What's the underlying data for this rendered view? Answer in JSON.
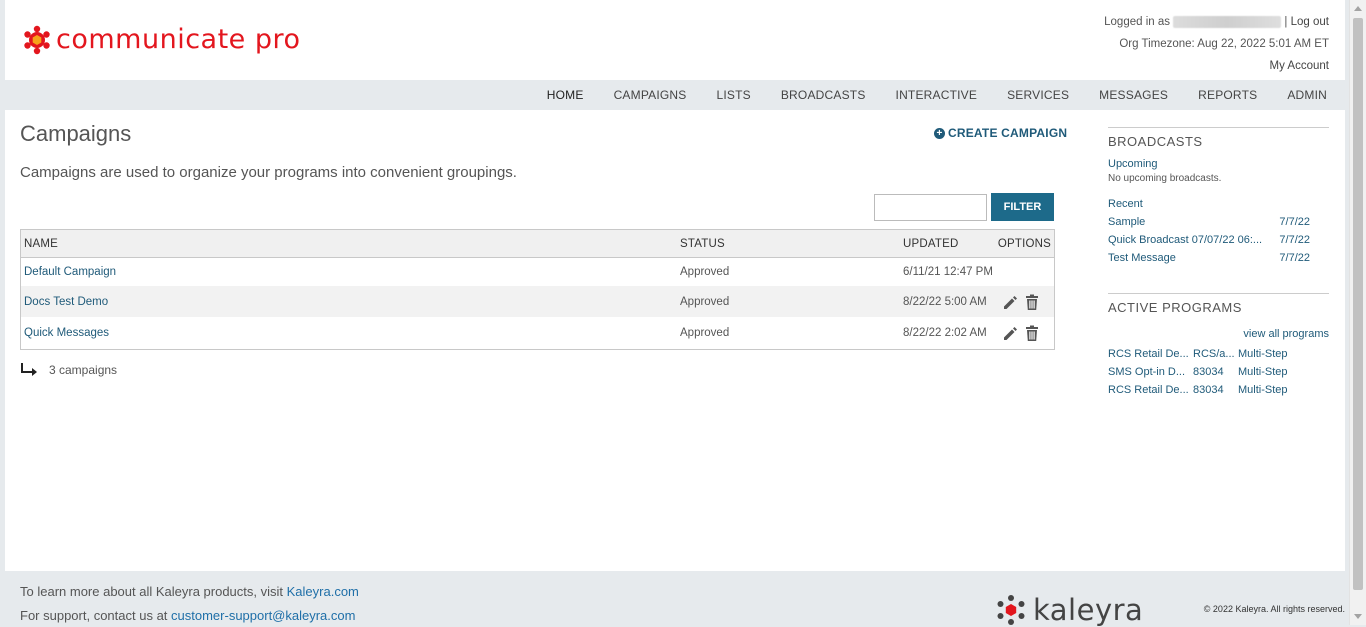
{
  "brand": {
    "name": "communicate pro",
    "accent": "#e3161e"
  },
  "header": {
    "logged_in_prefix": "Logged in as",
    "separator": "|",
    "logout": "Log out",
    "timezone": "Org Timezone: Aug 22, 2022 5:01 AM ET",
    "my_account": "My Account"
  },
  "nav": {
    "items": [
      "HOME",
      "CAMPAIGNS",
      "LISTS",
      "BROADCASTS",
      "INTERACTIVE",
      "SERVICES",
      "MESSAGES",
      "REPORTS",
      "ADMIN"
    ],
    "active": "HOME"
  },
  "main": {
    "title": "Campaigns",
    "create_label": "CREATE CAMPAIGN",
    "description": "Campaigns are used to organize your programs into convenient groupings.",
    "filter": {
      "value": "",
      "button": "FILTER"
    },
    "table": {
      "headers": {
        "name": "NAME",
        "status": "STATUS",
        "updated": "UPDATED",
        "options": "OPTIONS"
      },
      "rows": [
        {
          "name": "Default Campaign",
          "status": "Approved",
          "updated": "6/11/21 12:47 PM",
          "has_options": false
        },
        {
          "name": "Docs Test Demo",
          "status": "Approved",
          "updated": "8/22/22 5:00 AM",
          "has_options": true
        },
        {
          "name": "Quick Messages",
          "status": "Approved",
          "updated": "8/22/22 2:02 AM",
          "has_options": true
        }
      ]
    },
    "count_text": "3 campaigns"
  },
  "sidebar": {
    "broadcasts": {
      "title": "BROADCASTS",
      "upcoming_label": "Upcoming",
      "upcoming_empty": "No upcoming broadcasts.",
      "recent_label": "Recent",
      "recent": [
        {
          "name": "Sample",
          "date": "7/7/22"
        },
        {
          "name": "Quick Broadcast 07/07/22 06:...",
          "date": "7/7/22"
        },
        {
          "name": "Test Message",
          "date": "7/7/22"
        }
      ]
    },
    "programs": {
      "title": "ACTIVE PROGRAMS",
      "view_all": "view all programs",
      "items": [
        {
          "name": "RCS Retail De...",
          "code": "RCS/a...",
          "type": "Multi-Step"
        },
        {
          "name": "SMS Opt-in D...",
          "code": "83034",
          "type": "Multi-Step"
        },
        {
          "name": "RCS Retail De...",
          "code": "83034",
          "type": "Multi-Step"
        }
      ]
    }
  },
  "footer": {
    "learn_prefix": "To learn more about all Kaleyra products, visit",
    "learn_link": "Kaleyra.com",
    "support_prefix": "For support, contact us at",
    "support_link": "customer-support@kaleyra.com",
    "logo_text": "kaleyra",
    "copyright": "© 2022 Kaleyra. All rights reserved."
  },
  "icons": {
    "create": "plus-circle-icon",
    "edit": "pencil-icon",
    "delete": "trash-icon",
    "count": "return-arrow-icon"
  }
}
